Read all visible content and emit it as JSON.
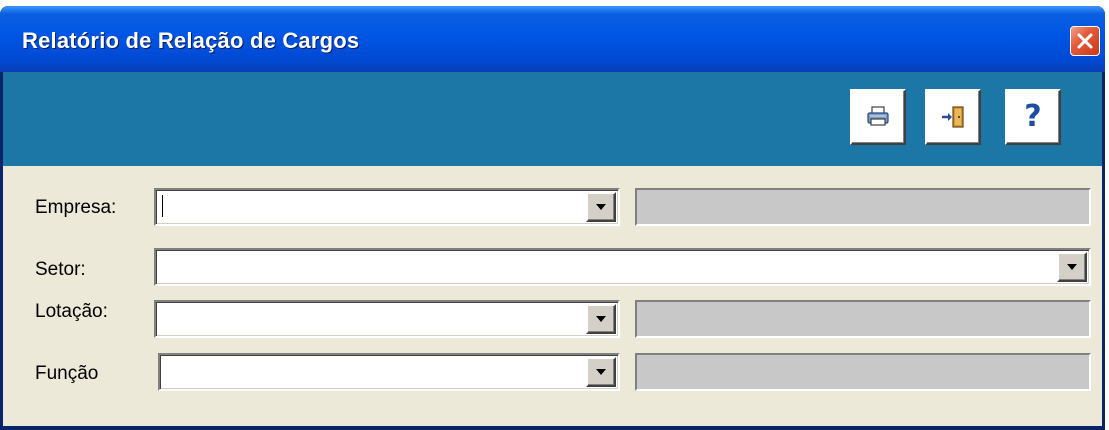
{
  "window": {
    "title": "Relatório de Relação de Cargos"
  },
  "toolbar": {
    "buttons": [
      {
        "name": "print",
        "icon": "printer-icon"
      },
      {
        "name": "exit",
        "icon": "exit-door-icon"
      },
      {
        "name": "help",
        "icon": "help-icon",
        "glyph": "?"
      }
    ]
  },
  "form": {
    "empresa": {
      "label": "Empresa:",
      "value": "",
      "description": ""
    },
    "setor": {
      "label": "Setor:",
      "value": ""
    },
    "lotacao": {
      "label": "Lotação:",
      "value": "",
      "description": ""
    },
    "funcao": {
      "label": "Função",
      "value": "",
      "description": ""
    }
  },
  "colors": {
    "titlebar": "#0055e5",
    "toolbar": "#1c76a6",
    "form_bg": "#ece9d8",
    "readonly_field": "#c8c8c8",
    "close_button": "#e25b3a"
  }
}
